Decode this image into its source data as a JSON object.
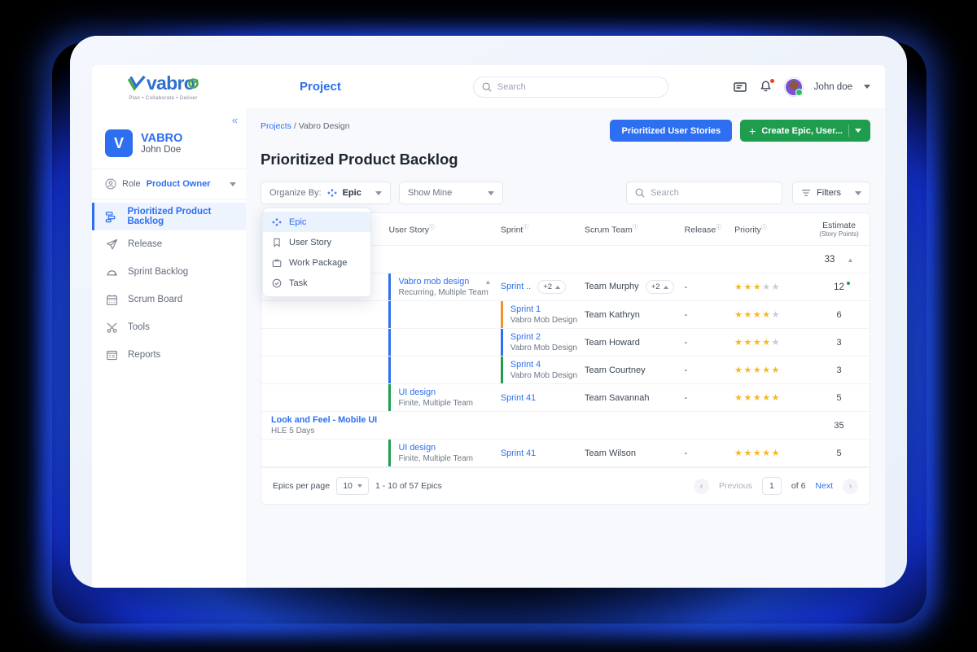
{
  "navbar": {
    "logo_text": "vabro",
    "logo_tagline": "Plan • Collaborate • Deliver",
    "project_link": "Project",
    "search_placeholder": "Search",
    "search_value": "",
    "username": "John doe"
  },
  "sidebar": {
    "collapse_icon": "chevron-double-left-icon",
    "project_initial": "V",
    "project_name": "VABRO",
    "project_owner": "John Doe",
    "role_label": "Role",
    "role_value": "Product Owner",
    "items": [
      {
        "label": "Prioritized Product Backlog",
        "icon": "backlog-icon",
        "active": true
      },
      {
        "label": "Release",
        "icon": "paper-plane-icon",
        "active": false
      },
      {
        "label": "Sprint Backlog",
        "icon": "sprint-icon",
        "active": false
      },
      {
        "label": "Scrum Board",
        "icon": "calendar-icon",
        "active": false
      },
      {
        "label": "Tools",
        "icon": "tools-icon",
        "active": false
      },
      {
        "label": "Reports",
        "icon": "report-icon",
        "active": false
      }
    ]
  },
  "breadcrumb": {
    "root": "Projects",
    "sep": "/",
    "current": "Vabro Design"
  },
  "page_title": "Prioritized Product Backlog",
  "header_actions": {
    "prioritized_button": "Prioritized User Stories",
    "create_button": "Create  Epic, User...",
    "create_plus": "+"
  },
  "toolbar": {
    "organize_label": "Organize By:",
    "organize_value": "Epic",
    "organize_icon": "epic-diamond-icon",
    "show_mine": "Show Mine",
    "search_placeholder": "Search",
    "search_value": "",
    "filters_label": "Filters",
    "filters_icon": "filter-icon"
  },
  "organize_menu": {
    "open": true,
    "items": [
      {
        "label": "Epic",
        "icon": "epic-diamond-icon",
        "selected": true
      },
      {
        "label": "User Story",
        "icon": "bookmark-icon",
        "selected": false
      },
      {
        "label": "Work Package",
        "icon": "briefcase-icon",
        "selected": false
      },
      {
        "label": "Task",
        "icon": "check-circle-icon",
        "selected": false
      }
    ]
  },
  "table": {
    "columns": [
      {
        "key": "epic",
        "label": "",
        "info": false
      },
      {
        "key": "user_story",
        "label": "User Story",
        "info": true
      },
      {
        "key": "sprint",
        "label": "Sprint",
        "info": true
      },
      {
        "key": "scrum_team",
        "label": "Scrum Team",
        "info": true
      },
      {
        "key": "release",
        "label": "Release",
        "info": true
      },
      {
        "key": "priority",
        "label": "Priority",
        "info": true
      },
      {
        "key": "estimate",
        "label": "Estimate",
        "sub": "(Story Points)",
        "info": false
      }
    ],
    "rows": [
      {
        "type": "group_total",
        "estimate": "33",
        "collapse_icon": "caret-up-icon"
      },
      {
        "type": "story",
        "epic_bar": "#2d6ff0",
        "user_story": "Vabro mob design",
        "user_story_sub": "Recurring, Multiple Team",
        "user_story_caret": "caret-up-icon",
        "sprint": "Sprint ..",
        "sprint_chip": "+2",
        "scrum_team": "Team  Murphy",
        "team_chip": "+2",
        "release": "-",
        "priority": 3,
        "priority_max": 5,
        "estimate": "12",
        "estimate_dot": true,
        "bar_color": ""
      },
      {
        "type": "story",
        "user_story": "",
        "sprint": "Sprint 1",
        "sprint_sub": "Vabro Mob Design",
        "scrum_team": "Team Kathryn",
        "release": "-",
        "priority": 4,
        "priority_max": 5,
        "estimate": "6",
        "bar_color": "#f0932b"
      },
      {
        "type": "story",
        "user_story": "",
        "sprint": "Sprint 2",
        "sprint_sub": "Vabro Mob Design",
        "scrum_team": "Team Howard",
        "release": "-",
        "priority": 4,
        "priority_max": 5,
        "estimate": "3",
        "bar_color": "#2d6ff0"
      },
      {
        "type": "story",
        "user_story": "",
        "sprint": "Sprint 4",
        "sprint_sub": "Vabro Mob Design",
        "scrum_team": "Team Courtney",
        "release": "-",
        "priority": 5,
        "priority_max": 5,
        "estimate": "3",
        "bar_color": "#1f9d4e"
      },
      {
        "type": "story",
        "user_story": "UI design",
        "user_story_sub": "Finite, Multiple Team",
        "sprint": "Sprint 41",
        "scrum_team": "Team Savannah",
        "release": "-",
        "priority": 5,
        "priority_max": 5,
        "estimate": "5",
        "bar_color": "#1f9d4e"
      },
      {
        "type": "epic_group",
        "epic": "Look and Feel - Mobile UI",
        "epic_sub": "HLE 5 Days",
        "estimate": "35"
      },
      {
        "type": "story",
        "user_story": "UI design",
        "user_story_sub": "Finite, Multiple Team",
        "sprint": "Sprint 41",
        "scrum_team": "Team Wilson",
        "release": "-",
        "priority": 5,
        "priority_max": 5,
        "estimate": "5",
        "bar_color": "#1f9d4e"
      }
    ]
  },
  "footer": {
    "per_page_label": "Epics per page",
    "per_page_value": "10",
    "range_text": "1 - 10 of 57 Epics",
    "previous": "Previous",
    "page_value": "1",
    "of_text": "of 6",
    "next": "Next"
  }
}
